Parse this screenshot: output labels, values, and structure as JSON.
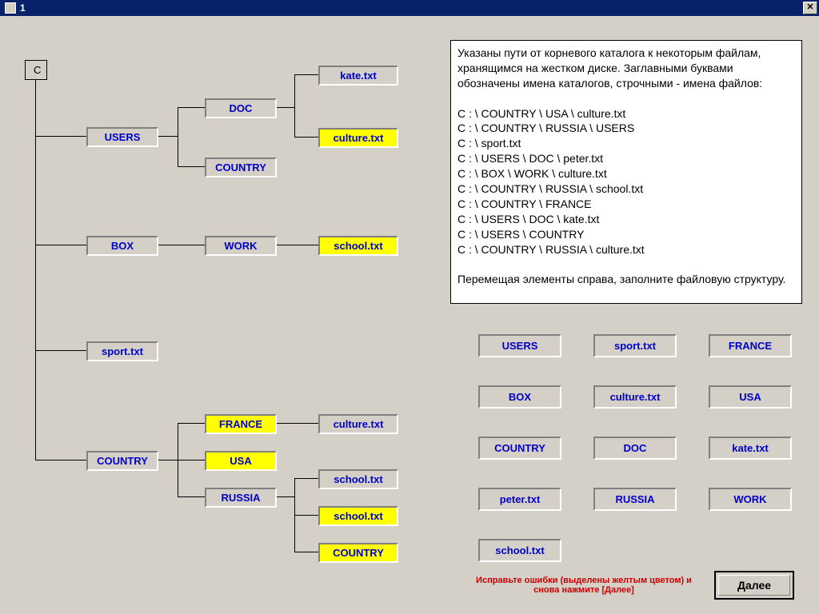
{
  "window": {
    "title": "1"
  },
  "tree": {
    "root": "C",
    "n_users": "USERS",
    "n_doc": "DOC",
    "n_country1": "COUNTRY",
    "f_kate": "kate.txt",
    "f_culture1": "culture.txt",
    "n_box": "BOX",
    "n_work": "WORK",
    "f_school1": "school.txt",
    "f_sport": "sport.txt",
    "n_country2": "COUNTRY",
    "n_france": "FRANCE",
    "n_usa": "USA",
    "n_russia": "RUSSIA",
    "f_culture2": "culture.txt",
    "f_school2": "school.txt",
    "f_school3": "school.txt",
    "n_country3": "COUNTRY"
  },
  "instructions": {
    "intro": "Указаны пути от корневого каталога к некоторым файлам, хранящимся на жестком диске. Заглавными буквами обозначены имена каталогов, строчными - имена файлов:",
    "paths": [
      "C : \\ COUNTRY \\ USA \\ culture.txt",
      "C : \\ COUNTRY \\ RUSSIA \\ USERS",
      "C : \\ sport.txt",
      "C : \\ USERS \\ DOC \\ peter.txt",
      "C : \\ BOX \\ WORK \\ culture.txt",
      "C : \\ COUNTRY \\ RUSSIA \\ school.txt",
      "C : \\ COUNTRY \\ FRANCE",
      "C : \\ USERS \\ DOC \\ kate.txt",
      "C : \\ USERS \\ COUNTRY",
      "C : \\ COUNTRY \\ RUSSIA \\ culture.txt"
    ],
    "outro": "Перемещая элементы справа, заполните файловую структуру."
  },
  "palette": [
    "USERS",
    "sport.txt",
    "FRANCE",
    "BOX",
    "culture.txt",
    "USA",
    "COUNTRY",
    "DOC",
    "kate.txt",
    "peter.txt",
    "RUSSIA",
    "WORK",
    "school.txt"
  ],
  "hint": "Исправьте ошибки (выделены желтым цветом) и снова нажмите  [Далее]",
  "next": "Далее"
}
